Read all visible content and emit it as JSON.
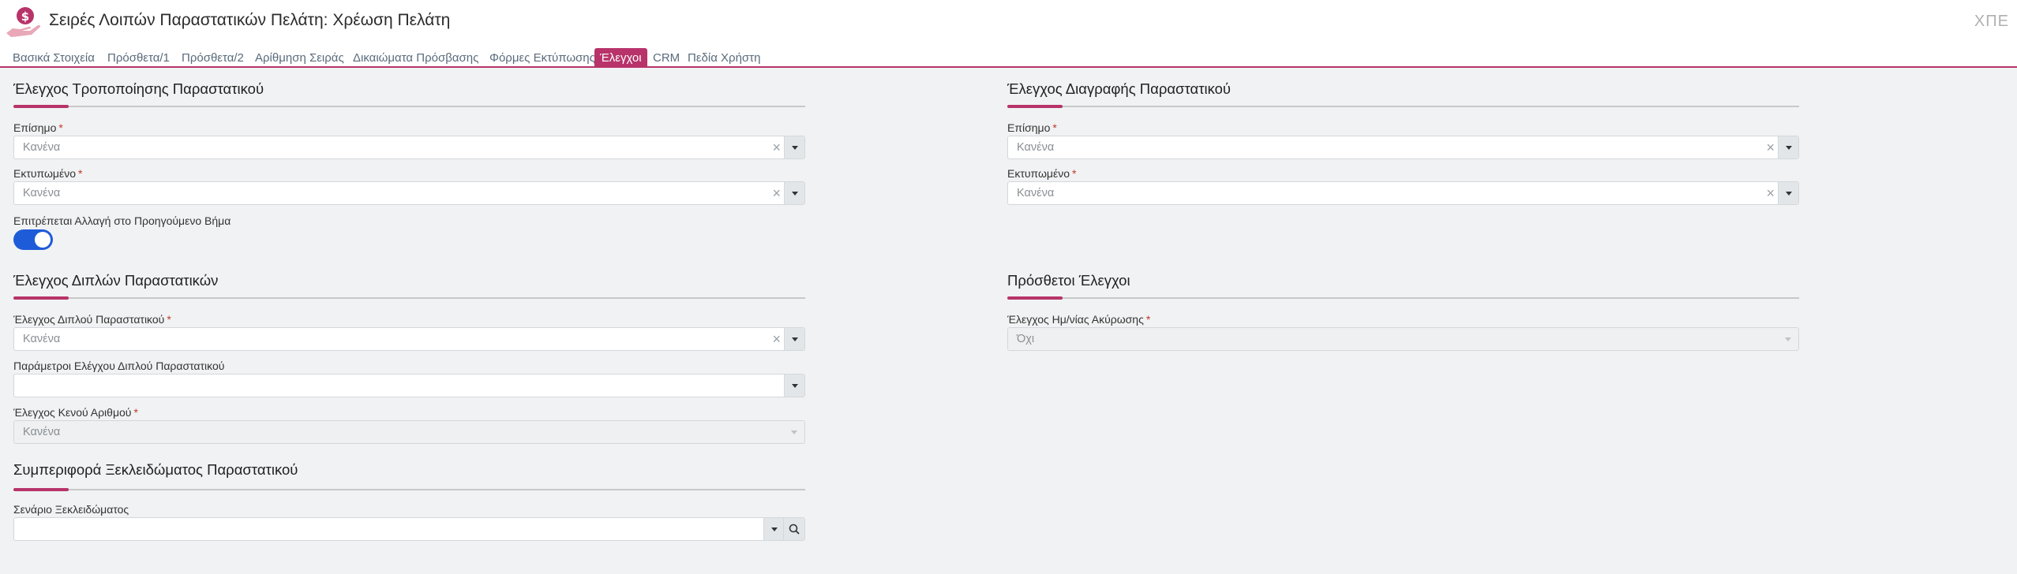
{
  "header": {
    "title": "Σειρές Λοιπών Παραστατικών Πελάτη: Χρέωση Πελάτη",
    "user_initials": "ΧΠΕ",
    "logo_icon": "hand-dollar-icon"
  },
  "tabs": [
    {
      "label": "Βασικά Στοιχεία",
      "active": false
    },
    {
      "label": "Πρόσθετα/1",
      "active": false
    },
    {
      "label": "Πρόσθετα/2",
      "active": false
    },
    {
      "label": "Αρίθμηση Σειράς",
      "active": false
    },
    {
      "label": "Δικαιώματα Πρόσβασης",
      "active": false
    },
    {
      "label": "Φόρμες Εκτύπωσης",
      "active": false
    },
    {
      "label": "Έλεγχοι",
      "active": true
    },
    {
      "label": "CRM",
      "active": false
    },
    {
      "label": "Πεδία Χρήστη",
      "active": false
    }
  ],
  "colors": {
    "accent": "#b8336a",
    "toggle_on": "#1e5bd8",
    "required": "#c0392b"
  },
  "edit_control": {
    "title": "Έλεγχος Τροποποίησης Παραστατικού",
    "official_label": "Επίσημο",
    "official_value": "Κανένα",
    "printed_label": "Εκτυπωμένο",
    "printed_value": "Κανένα",
    "allow_prev_step_label": "Επιτρέπεται Αλλαγή στο Προηγούμενο Βήμα",
    "allow_prev_step_on": true
  },
  "delete_control": {
    "title": "Έλεγχος Διαγραφής Παραστατικού",
    "official_label": "Επίσημο",
    "official_value": "Κανένα",
    "printed_label": "Εκτυπωμένο",
    "printed_value": "Κανένα"
  },
  "duplicate_control": {
    "title": "Έλεγχος Διπλών Παραστατικών",
    "check_label": "Έλεγχος Διπλού Παραστατικού",
    "check_value": "Κανένα",
    "params_label": "Παράμετροι Ελέγχου Διπλού Παραστατικού",
    "params_value": "",
    "empty_number_label": "Έλεγχος Κενού Αριθμού",
    "empty_number_value": "Κανένα"
  },
  "extra_controls": {
    "title": "Πρόσθετοι Έλεγχοι",
    "cancel_date_label": "Έλεγχος Ημ/νίας Ακύρωσης",
    "cancel_date_value": "Όχι"
  },
  "unlock_behavior": {
    "title": "Συμπεριφορά Ξεκλειδώματος Παραστατικού",
    "scenario_label": "Σενάριο Ξεκλειδώματος",
    "scenario_value": ""
  },
  "required_mark": "*",
  "clear_glyph": "×",
  "search_icon": "magnifier-icon"
}
